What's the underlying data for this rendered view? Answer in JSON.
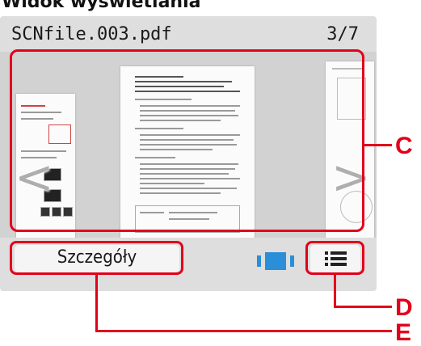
{
  "heading": "Widok wyświetlania",
  "header": {
    "filename": "SCNfile.003.pdf",
    "page_counter": "3/7"
  },
  "viewer": {
    "prev_arrow": "<",
    "next_arrow": ">"
  },
  "footer": {
    "details_label": "Szczegóły"
  },
  "callouts": [
    "C",
    "D",
    "E"
  ],
  "colors": {
    "callout_red": "#e2001a",
    "panel_gray": "#dedede",
    "viewer_gray": "#d2d2d2",
    "accent_blue": "#2a8fd8"
  }
}
